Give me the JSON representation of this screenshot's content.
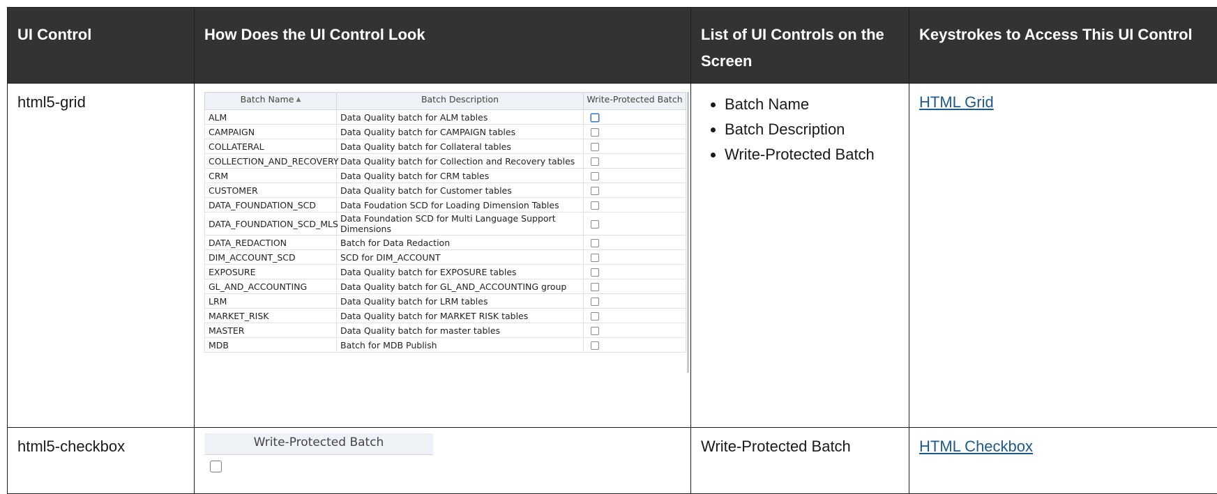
{
  "headers": {
    "ui_control": "UI Control",
    "look": "How Does the UI Control Look",
    "list": "List of UI Controls on the Screen",
    "keystrokes": "Keystrokes to Access This UI Control"
  },
  "rows": [
    {
      "ui_control": "html5-grid",
      "controls": [
        "Batch Name",
        "Batch Description",
        "Write-Protected Batch"
      ],
      "link": "HTML Grid"
    },
    {
      "ui_control": "html5-checkbox",
      "controls_text": "Write-Protected Batch",
      "link": "HTML Checkbox"
    }
  ],
  "grid": {
    "columns": [
      "Batch Name",
      "Batch Description",
      "Write-Protected Batch"
    ],
    "sort_icon": "sort-ascending-icon",
    "items": [
      {
        "name": "ALM",
        "desc": "Data Quality batch for ALM tables"
      },
      {
        "name": "CAMPAIGN",
        "desc": "Data Quality batch for CAMPAIGN tables"
      },
      {
        "name": "COLLATERAL",
        "desc": "Data Quality batch for Collateral tables"
      },
      {
        "name": "COLLECTION_AND_RECOVERY",
        "desc": "Data Quality batch for Collection and Recovery tables"
      },
      {
        "name": "CRM",
        "desc": "Data Quality batch for CRM tables"
      },
      {
        "name": "CUSTOMER",
        "desc": "Data Quality batch for Customer tables"
      },
      {
        "name": "DATA_FOUNDATION_SCD",
        "desc": "Data Foudation SCD for Loading Dimension Tables"
      },
      {
        "name": "DATA_FOUNDATION_SCD_MLS",
        "desc": "Data Foundation SCD for Multi Language Support Dimensions"
      },
      {
        "name": "DATA_REDACTION",
        "desc": "Batch for Data Redaction"
      },
      {
        "name": "DIM_ACCOUNT_SCD",
        "desc": "SCD for DIM_ACCOUNT"
      },
      {
        "name": "EXPOSURE",
        "desc": "Data Quality batch for EXPOSURE tables"
      },
      {
        "name": "GL_AND_ACCOUNTING",
        "desc": "Data Quality batch for GL_AND_ACCOUNTING group"
      },
      {
        "name": "LRM",
        "desc": "Data Quality batch for LRM tables"
      },
      {
        "name": "MARKET_RISK",
        "desc": "Data Quality batch for MARKET RISK tables"
      },
      {
        "name": "MASTER",
        "desc": "Data Quality batch for master tables"
      },
      {
        "name": "MDB",
        "desc": "Batch for MDB Publish"
      }
    ]
  },
  "checkbox_demo": {
    "header": "Write-Protected Batch"
  }
}
